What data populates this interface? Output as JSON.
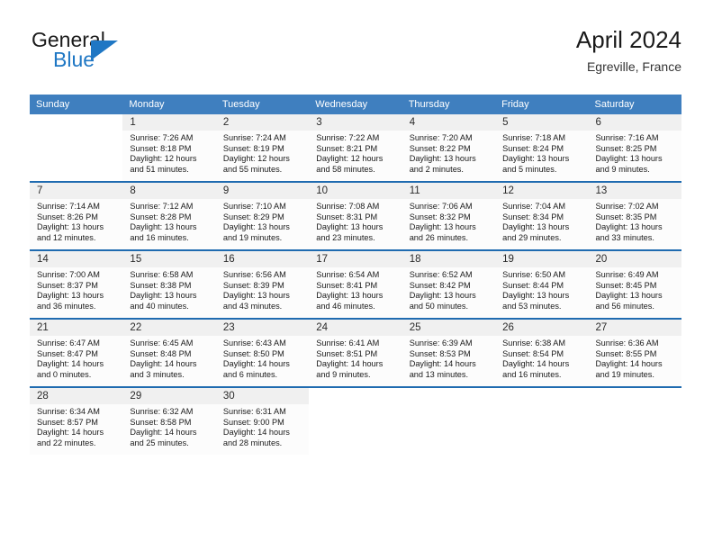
{
  "brand": {
    "name_part1": "General",
    "name_part2": "Blue"
  },
  "header": {
    "title": "April 2024",
    "subtitle": "Egreville, France"
  },
  "weekday_headers": [
    "Sunday",
    "Monday",
    "Tuesday",
    "Wednesday",
    "Thursday",
    "Friday",
    "Saturday"
  ],
  "colors": {
    "header_blue": "#3f7fbf",
    "separator_blue": "#1f6bb0",
    "brand_blue": "#1f77c4",
    "daynum_bg": "#f0f0f0",
    "cell_bg": "#fcfcfc"
  },
  "weeks": [
    {
      "days": [
        {
          "num": "",
          "sunrise": "",
          "sunset": "",
          "daylight1": "",
          "daylight2": "",
          "empty": true
        },
        {
          "num": "1",
          "sunrise": "Sunrise: 7:26 AM",
          "sunset": "Sunset: 8:18 PM",
          "daylight1": "Daylight: 12 hours",
          "daylight2": "and 51 minutes.",
          "empty": false
        },
        {
          "num": "2",
          "sunrise": "Sunrise: 7:24 AM",
          "sunset": "Sunset: 8:19 PM",
          "daylight1": "Daylight: 12 hours",
          "daylight2": "and 55 minutes.",
          "empty": false
        },
        {
          "num": "3",
          "sunrise": "Sunrise: 7:22 AM",
          "sunset": "Sunset: 8:21 PM",
          "daylight1": "Daylight: 12 hours",
          "daylight2": "and 58 minutes.",
          "empty": false
        },
        {
          "num": "4",
          "sunrise": "Sunrise: 7:20 AM",
          "sunset": "Sunset: 8:22 PM",
          "daylight1": "Daylight: 13 hours",
          "daylight2": "and 2 minutes.",
          "empty": false
        },
        {
          "num": "5",
          "sunrise": "Sunrise: 7:18 AM",
          "sunset": "Sunset: 8:24 PM",
          "daylight1": "Daylight: 13 hours",
          "daylight2": "and 5 minutes.",
          "empty": false
        },
        {
          "num": "6",
          "sunrise": "Sunrise: 7:16 AM",
          "sunset": "Sunset: 8:25 PM",
          "daylight1": "Daylight: 13 hours",
          "daylight2": "and 9 minutes.",
          "empty": false
        }
      ]
    },
    {
      "days": [
        {
          "num": "7",
          "sunrise": "Sunrise: 7:14 AM",
          "sunset": "Sunset: 8:26 PM",
          "daylight1": "Daylight: 13 hours",
          "daylight2": "and 12 minutes.",
          "empty": false
        },
        {
          "num": "8",
          "sunrise": "Sunrise: 7:12 AM",
          "sunset": "Sunset: 8:28 PM",
          "daylight1": "Daylight: 13 hours",
          "daylight2": "and 16 minutes.",
          "empty": false
        },
        {
          "num": "9",
          "sunrise": "Sunrise: 7:10 AM",
          "sunset": "Sunset: 8:29 PM",
          "daylight1": "Daylight: 13 hours",
          "daylight2": "and 19 minutes.",
          "empty": false
        },
        {
          "num": "10",
          "sunrise": "Sunrise: 7:08 AM",
          "sunset": "Sunset: 8:31 PM",
          "daylight1": "Daylight: 13 hours",
          "daylight2": "and 23 minutes.",
          "empty": false
        },
        {
          "num": "11",
          "sunrise": "Sunrise: 7:06 AM",
          "sunset": "Sunset: 8:32 PM",
          "daylight1": "Daylight: 13 hours",
          "daylight2": "and 26 minutes.",
          "empty": false
        },
        {
          "num": "12",
          "sunrise": "Sunrise: 7:04 AM",
          "sunset": "Sunset: 8:34 PM",
          "daylight1": "Daylight: 13 hours",
          "daylight2": "and 29 minutes.",
          "empty": false
        },
        {
          "num": "13",
          "sunrise": "Sunrise: 7:02 AM",
          "sunset": "Sunset: 8:35 PM",
          "daylight1": "Daylight: 13 hours",
          "daylight2": "and 33 minutes.",
          "empty": false
        }
      ]
    },
    {
      "days": [
        {
          "num": "14",
          "sunrise": "Sunrise: 7:00 AM",
          "sunset": "Sunset: 8:37 PM",
          "daylight1": "Daylight: 13 hours",
          "daylight2": "and 36 minutes.",
          "empty": false
        },
        {
          "num": "15",
          "sunrise": "Sunrise: 6:58 AM",
          "sunset": "Sunset: 8:38 PM",
          "daylight1": "Daylight: 13 hours",
          "daylight2": "and 40 minutes.",
          "empty": false
        },
        {
          "num": "16",
          "sunrise": "Sunrise: 6:56 AM",
          "sunset": "Sunset: 8:39 PM",
          "daylight1": "Daylight: 13 hours",
          "daylight2": "and 43 minutes.",
          "empty": false
        },
        {
          "num": "17",
          "sunrise": "Sunrise: 6:54 AM",
          "sunset": "Sunset: 8:41 PM",
          "daylight1": "Daylight: 13 hours",
          "daylight2": "and 46 minutes.",
          "empty": false
        },
        {
          "num": "18",
          "sunrise": "Sunrise: 6:52 AM",
          "sunset": "Sunset: 8:42 PM",
          "daylight1": "Daylight: 13 hours",
          "daylight2": "and 50 minutes.",
          "empty": false
        },
        {
          "num": "19",
          "sunrise": "Sunrise: 6:50 AM",
          "sunset": "Sunset: 8:44 PM",
          "daylight1": "Daylight: 13 hours",
          "daylight2": "and 53 minutes.",
          "empty": false
        },
        {
          "num": "20",
          "sunrise": "Sunrise: 6:49 AM",
          "sunset": "Sunset: 8:45 PM",
          "daylight1": "Daylight: 13 hours",
          "daylight2": "and 56 minutes.",
          "empty": false
        }
      ]
    },
    {
      "days": [
        {
          "num": "21",
          "sunrise": "Sunrise: 6:47 AM",
          "sunset": "Sunset: 8:47 PM",
          "daylight1": "Daylight: 14 hours",
          "daylight2": "and 0 minutes.",
          "empty": false
        },
        {
          "num": "22",
          "sunrise": "Sunrise: 6:45 AM",
          "sunset": "Sunset: 8:48 PM",
          "daylight1": "Daylight: 14 hours",
          "daylight2": "and 3 minutes.",
          "empty": false
        },
        {
          "num": "23",
          "sunrise": "Sunrise: 6:43 AM",
          "sunset": "Sunset: 8:50 PM",
          "daylight1": "Daylight: 14 hours",
          "daylight2": "and 6 minutes.",
          "empty": false
        },
        {
          "num": "24",
          "sunrise": "Sunrise: 6:41 AM",
          "sunset": "Sunset: 8:51 PM",
          "daylight1": "Daylight: 14 hours",
          "daylight2": "and 9 minutes.",
          "empty": false
        },
        {
          "num": "25",
          "sunrise": "Sunrise: 6:39 AM",
          "sunset": "Sunset: 8:53 PM",
          "daylight1": "Daylight: 14 hours",
          "daylight2": "and 13 minutes.",
          "empty": false
        },
        {
          "num": "26",
          "sunrise": "Sunrise: 6:38 AM",
          "sunset": "Sunset: 8:54 PM",
          "daylight1": "Daylight: 14 hours",
          "daylight2": "and 16 minutes.",
          "empty": false
        },
        {
          "num": "27",
          "sunrise": "Sunrise: 6:36 AM",
          "sunset": "Sunset: 8:55 PM",
          "daylight1": "Daylight: 14 hours",
          "daylight2": "and 19 minutes.",
          "empty": false
        }
      ]
    },
    {
      "days": [
        {
          "num": "28",
          "sunrise": "Sunrise: 6:34 AM",
          "sunset": "Sunset: 8:57 PM",
          "daylight1": "Daylight: 14 hours",
          "daylight2": "and 22 minutes.",
          "empty": false
        },
        {
          "num": "29",
          "sunrise": "Sunrise: 6:32 AM",
          "sunset": "Sunset: 8:58 PM",
          "daylight1": "Daylight: 14 hours",
          "daylight2": "and 25 minutes.",
          "empty": false
        },
        {
          "num": "30",
          "sunrise": "Sunrise: 6:31 AM",
          "sunset": "Sunset: 9:00 PM",
          "daylight1": "Daylight: 14 hours",
          "daylight2": "and 28 minutes.",
          "empty": false
        },
        {
          "num": "",
          "sunrise": "",
          "sunset": "",
          "daylight1": "",
          "daylight2": "",
          "empty": true
        },
        {
          "num": "",
          "sunrise": "",
          "sunset": "",
          "daylight1": "",
          "daylight2": "",
          "empty": true
        },
        {
          "num": "",
          "sunrise": "",
          "sunset": "",
          "daylight1": "",
          "daylight2": "",
          "empty": true
        },
        {
          "num": "",
          "sunrise": "",
          "sunset": "",
          "daylight1": "",
          "daylight2": "",
          "empty": true
        }
      ]
    }
  ]
}
